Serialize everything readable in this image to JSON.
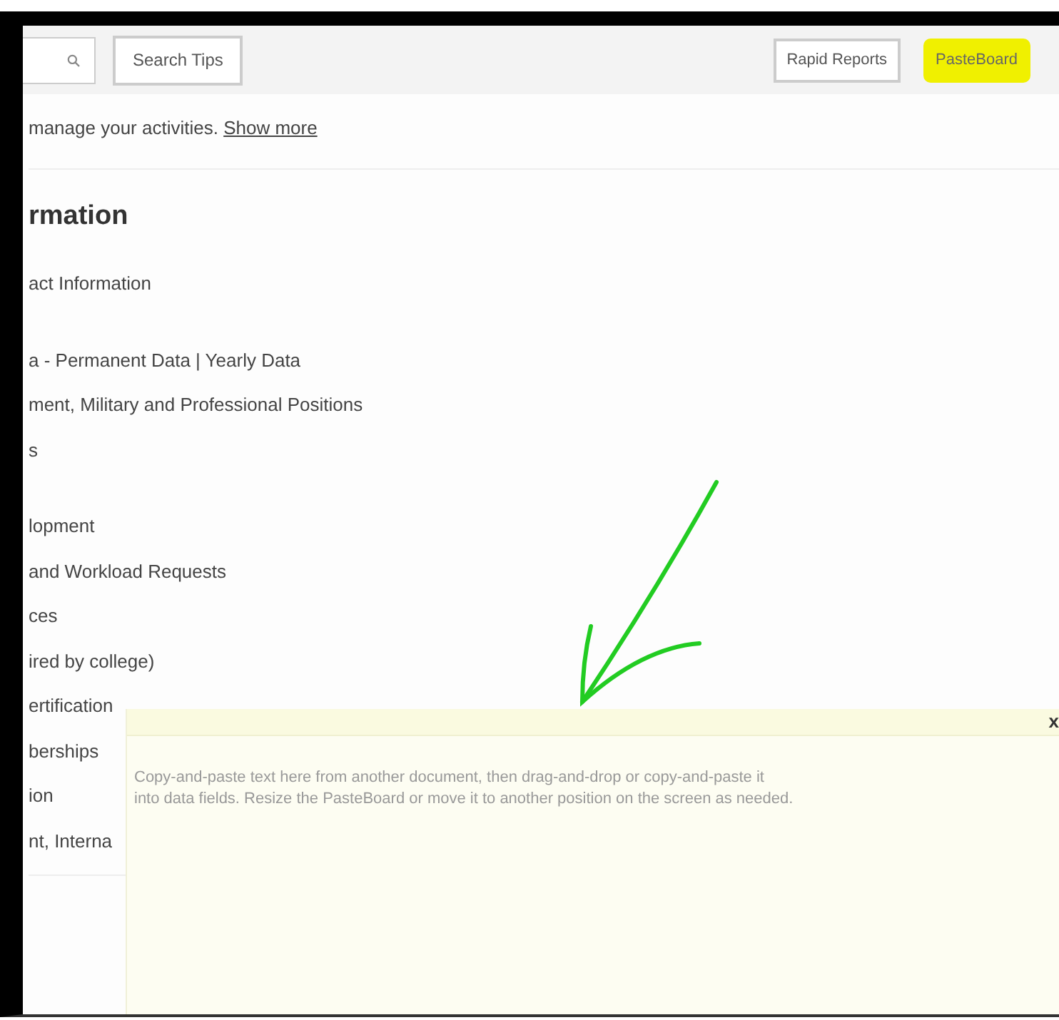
{
  "toolbar": {
    "left_buttons": [
      {
        "label": "Search Tips",
        "highlighted": false
      }
    ],
    "right_buttons": [
      {
        "label": "Rapid Reports",
        "highlighted": false
      },
      {
        "label": "PasteBoard",
        "highlighted": true
      }
    ]
  },
  "intro": {
    "text": "manage your activities.",
    "link": "Show more"
  },
  "heading": "rmation",
  "groups": [
    [
      "act Information"
    ],
    [
      "a - Permanent Data | Yearly Data",
      "ment, Military and Professional Positions",
      "s"
    ],
    [
      "lopment",
      " and Workload Requests",
      "ces",
      "ired by college)",
      "ertification",
      "berships",
      "ion",
      "nt, Interna"
    ]
  ],
  "pasteboard": {
    "close": "x",
    "text": "Copy-and-paste text here from another document, then drag-and-drop or copy-and-paste it\ninto data fields. Resize the PasteBoard or move it to another position on the screen as needed."
  }
}
